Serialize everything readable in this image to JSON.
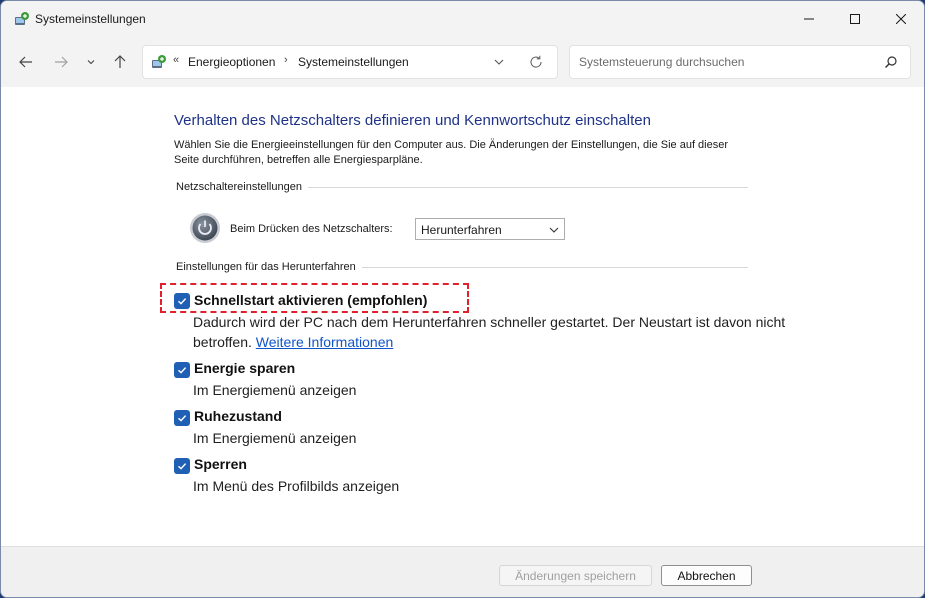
{
  "window": {
    "title": "Systemeinstellungen"
  },
  "address": {
    "prefix": "«",
    "crumbs": [
      "Energieoptionen",
      "Systemeinstellungen"
    ],
    "separator": "›"
  },
  "search": {
    "placeholder": "Systemsteuerung durchsuchen"
  },
  "main": {
    "title": "Verhalten des Netzschalters definieren und Kennwortschutz einschalten",
    "description": "Wählen Sie die Energieeinstellungen für den Computer aus. Die Änderungen der Einstellungen, die Sie auf dieser Seite durchführen, betreffen alle Energiesparpläne.",
    "power_section_header": "Netzschaltereinstellungen",
    "power_button_label": "Beim Drücken des Netzschalters:",
    "power_button_value": "Herunterfahren",
    "shutdown_section_header": "Einstellungen für das Herunterfahren",
    "options": [
      {
        "label": "Schnellstart aktivieren (empfohlen)",
        "checked": true,
        "desc": "Dadurch wird der PC nach dem Herunterfahren schneller gestartet. Der Neustart ist davon nicht betroffen.",
        "link": "Weitere Informationen"
      },
      {
        "label": "Energie sparen",
        "checked": true,
        "desc": "Im Energiemenü anzeigen"
      },
      {
        "label": "Ruhezustand",
        "checked": true,
        "desc": "Im Energiemenü anzeigen"
      },
      {
        "label": "Sperren",
        "checked": true,
        "desc": "Im Menü des Profilbilds anzeigen"
      }
    ]
  },
  "footer": {
    "save_label": "Änderungen speichern",
    "cancel_label": "Abbrechen"
  },
  "colors": {
    "title_blue": "#1e3287",
    "checkbox_blue": "#1f5fb4",
    "link_blue": "#0f55c8",
    "highlight_red": "#e0202c"
  },
  "icons": [
    "control-panel-icon",
    "minimize-icon",
    "maximize-icon",
    "close-icon",
    "back-arrow-icon",
    "forward-arrow-icon",
    "recent-dropdown-icon",
    "up-arrow-icon",
    "address-dropdown-icon",
    "refresh-icon",
    "search-icon",
    "power-icon",
    "checkmark-icon"
  ]
}
